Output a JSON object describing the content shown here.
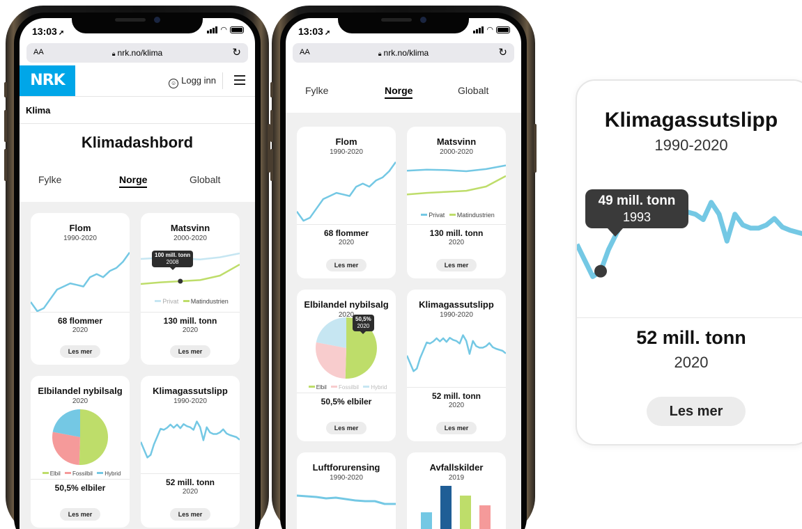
{
  "browser": {
    "time": "13:03",
    "aa": "AA",
    "url": "nrk.no/klima"
  },
  "site": {
    "logo": "NRK",
    "login": "Logg inn",
    "section": "Klima",
    "page_title": "Klimadashbord"
  },
  "tabs": [
    "Fylke",
    "Norge",
    "Globalt"
  ],
  "active_tab": "Norge",
  "more_label": "Les mer",
  "cards": {
    "flom": {
      "title": "Flom",
      "period": "1990-2020",
      "value": "68 flommer",
      "year": "2020"
    },
    "matsvinn": {
      "title": "Matsvinn",
      "period": "2000-2020",
      "value": "130 mill. tonn",
      "year": "2020",
      "legend": [
        "Privat",
        "Matindustrien"
      ],
      "tooltip_value": "100 mill. tonn",
      "tooltip_year": "2008"
    },
    "elbil": {
      "title": "Elbilandel nybilsalg",
      "period": "2020",
      "value": "50,5% elbiler",
      "legend": [
        "Elbil",
        "Fossilbil",
        "Hybrid"
      ],
      "tooltip_value": "50,5%",
      "tooltip_year": "2020"
    },
    "klimagass": {
      "title": "Klimagassutslipp",
      "period": "1990-2020",
      "value": "52 mill. tonn",
      "year": "2020"
    },
    "luft": {
      "title": "Luftforurensing",
      "period": "1990-2020"
    },
    "avfall": {
      "title": "Avfallskilder",
      "period": "2019"
    }
  },
  "zoom": {
    "title": "Klimagassutslipp",
    "period": "1990-2020",
    "tooltip_value": "49 mill. tonn",
    "tooltip_year": "1993",
    "value": "52 mill. tonn",
    "year": "2020",
    "more": "Les mer"
  },
  "colors": {
    "blue": "#74c8e4",
    "green": "#bedd6a",
    "pink": "#f59a9a",
    "lightpink": "#f8cccd",
    "lightblue": "#c6e6f2",
    "darkblue": "#1f5e96",
    "nrk": "#00a6e8"
  },
  "chart_data": [
    {
      "type": "line",
      "title": "Flom",
      "x": [
        1990,
        1992,
        1994,
        1996,
        1998,
        2000,
        2002,
        2004,
        2006,
        2008,
        2010,
        2012,
        2014,
        2016,
        2018,
        2020
      ],
      "series": [
        {
          "values": [
            40,
            34,
            36,
            42,
            48,
            50,
            52,
            51,
            50,
            56,
            58,
            56,
            60,
            62,
            66,
            72
          ]
        }
      ]
    },
    {
      "type": "line",
      "title": "Matsvinn",
      "x": [
        2000,
        2004,
        2008,
        2012,
        2016,
        2020
      ],
      "series": [
        {
          "name": "Privat",
          "values": [
            140,
            142,
            141,
            139,
            143,
            150
          ]
        },
        {
          "name": "Matindustrien",
          "values": [
            95,
            98,
            100,
            102,
            110,
            130
          ]
        }
      ]
    },
    {
      "type": "pie",
      "title": "Elbilandel nybilsalg",
      "categories": [
        "Elbil",
        "Fossilbil",
        "Hybrid"
      ],
      "values": [
        50.5,
        27.5,
        22.0
      ]
    },
    {
      "type": "line",
      "title": "Klimagassutslipp",
      "x": [
        1990,
        1991,
        1992,
        1993,
        1994,
        1995,
        1996,
        1997,
        1998,
        1999,
        2000,
        2001,
        2002,
        2003,
        2004,
        2005,
        2006,
        2007,
        2008,
        2009,
        2010,
        2011,
        2012,
        2013,
        2014,
        2015,
        2016,
        2017,
        2018,
        2019,
        2020
      ],
      "series": [
        {
          "values": [
            51.5,
            50,
            48.5,
            49,
            51,
            52.5,
            54,
            53.8,
            54.2,
            54.8,
            54.2,
            54.8,
            54.1,
            54.9,
            54.5,
            54.3,
            53.8,
            55.4,
            54.3,
            51.8,
            54.3,
            53.3,
            53,
            53,
            53.3,
            53.9,
            53.1,
            52.8,
            52.6,
            52.4,
            51.9
          ]
        }
      ]
    }
  ]
}
